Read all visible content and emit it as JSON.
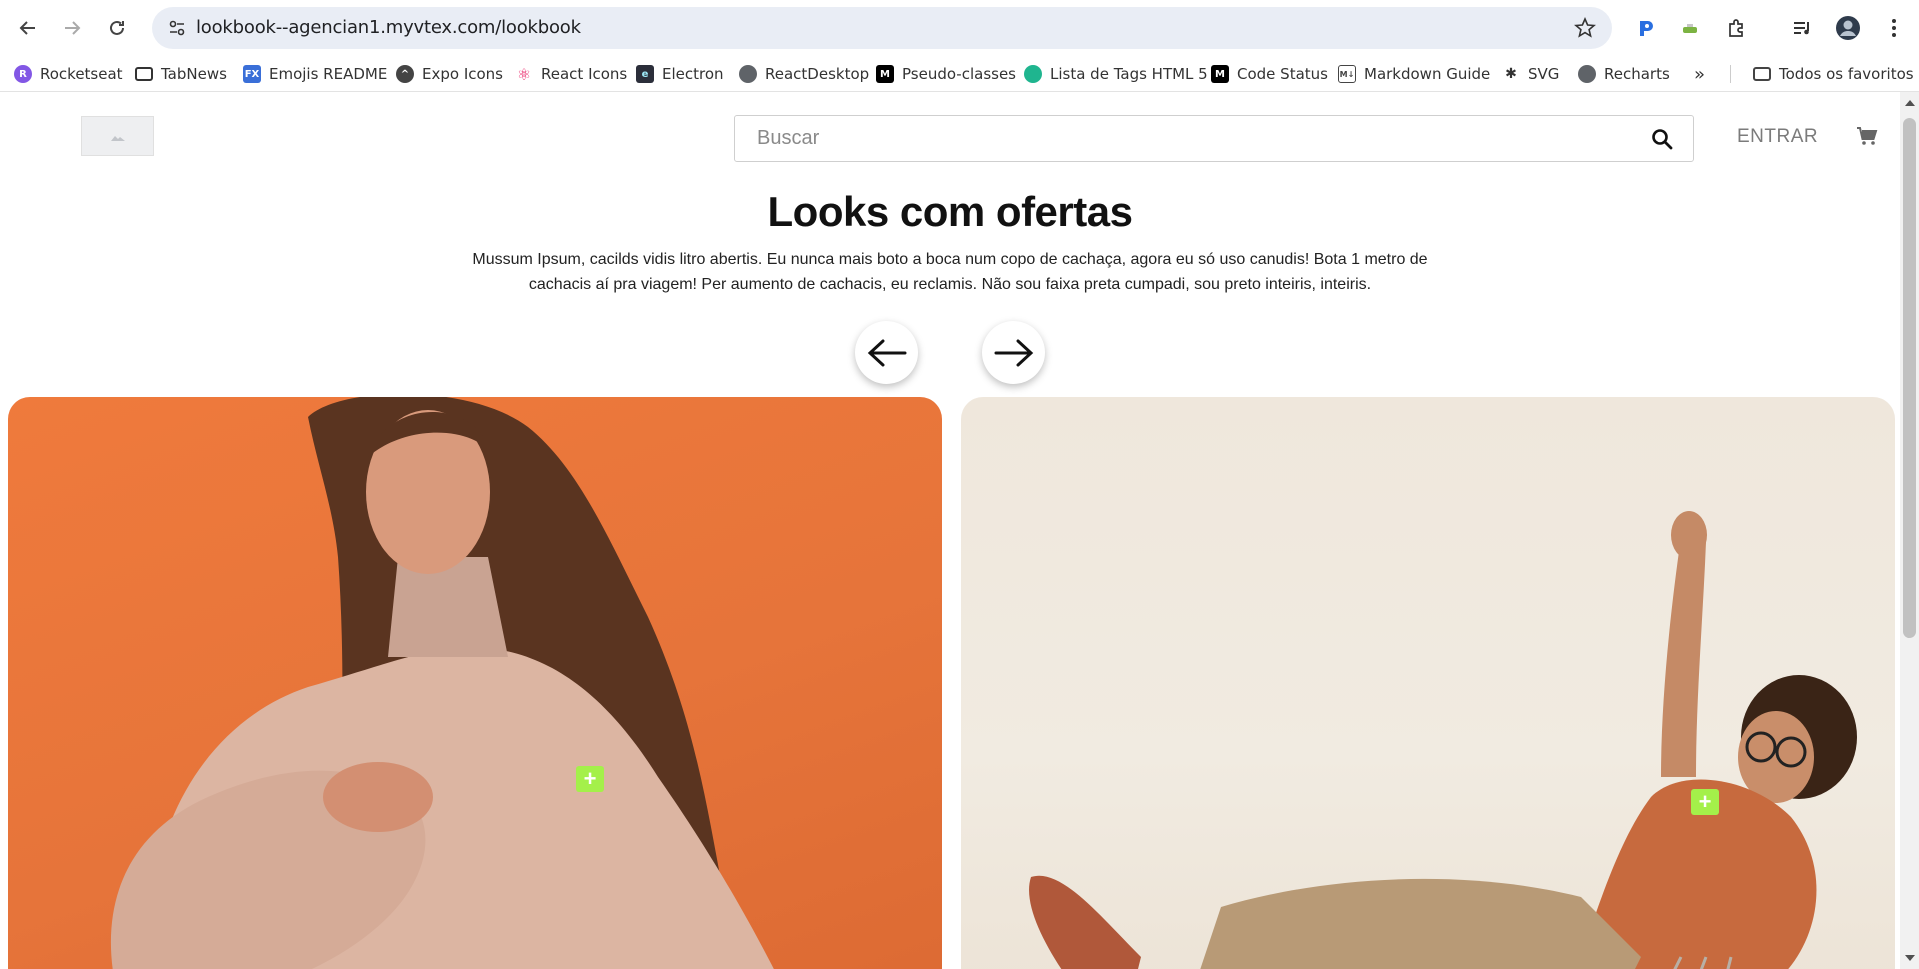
{
  "browser": {
    "url": "lookbook--agencian1.myvtex.com/lookbook",
    "bookmarks": [
      {
        "label": "Rocketseat",
        "icon": "rocketseat-icon",
        "color": "#8257e5"
      },
      {
        "label": "TabNews",
        "icon": "folder-icon",
        "color": "#333333"
      },
      {
        "label": "Emojis README",
        "icon": "fx-icon",
        "color": "#3a6fd8"
      },
      {
        "label": "Expo Icons",
        "icon": "expo-icon",
        "color": "#444444"
      },
      {
        "label": "React Icons",
        "icon": "react-icon",
        "color": "#e91e63"
      },
      {
        "label": "Electron",
        "icon": "electron-icon",
        "color": "#2b2e3a"
      },
      {
        "label": "ReactDesktop",
        "icon": "globe-icon",
        "color": "#5f6368"
      },
      {
        "label": "Pseudo-classes",
        "icon": "mdn-icon",
        "color": "#000000"
      },
      {
        "label": "Lista de Tags HTML 5",
        "icon": "hex-icon",
        "color": "#1fb58f"
      },
      {
        "label": "Code Status",
        "icon": "mdn-icon",
        "color": "#000000"
      },
      {
        "label": "Markdown Guide",
        "icon": "markdown-icon",
        "color": "#444444"
      },
      {
        "label": "SVG",
        "icon": "svg-icon",
        "color": "#333333"
      },
      {
        "label": "Recharts",
        "icon": "globe-icon",
        "color": "#5f6368"
      }
    ],
    "all_bookmarks": "Todos os favoritos"
  },
  "header": {
    "search_placeholder": "Buscar",
    "login_label": "ENTRAR"
  },
  "hero": {
    "title": "Looks com ofertas",
    "description": "Mussum Ipsum, cacilds vidis litro abertis. Eu nunca mais boto a boca num copo de cachaça, agora eu só uso canudis! Bota 1 metro de cachacis aí pra viagem! Per aumento de cachacis, eu reclamis. Não sou faixa preta cumpadi, sou preto inteiris, inteiris."
  },
  "looks": [
    {
      "name": "look-woman-orange",
      "background": "#e6743a",
      "hotspot_label": "+"
    },
    {
      "name": "look-man-chair",
      "background": "#efe7dc",
      "hotspot_label": "+"
    }
  ],
  "colors": {
    "hotspot": "#a4f04a",
    "accent_text": "#111111"
  }
}
